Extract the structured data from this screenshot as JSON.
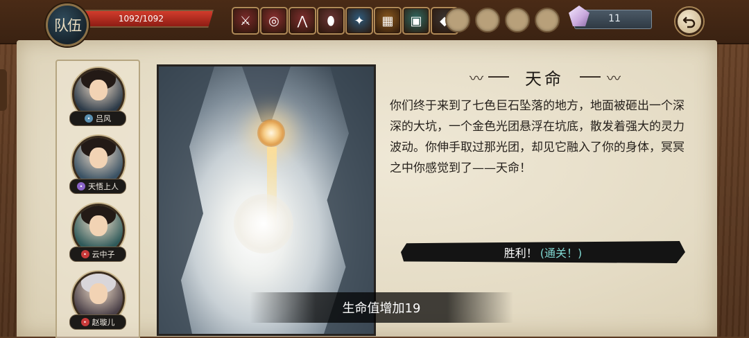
{
  "team": {
    "badge_label": "队伍",
    "hp_text": "1092/1092",
    "hp_fraction": 1.0
  },
  "inventory": {
    "items": [
      {
        "name": "sword-rack-icon",
        "bg": "#7a2a2a",
        "glyph": "⚔"
      },
      {
        "name": "spiral-scroll-icon",
        "bg": "#8a3030",
        "glyph": "◎"
      },
      {
        "name": "claw-icon",
        "bg": "#7d2e2e",
        "glyph": "⋀"
      },
      {
        "name": "rainbow-egg-icon",
        "bg": "#6a3636",
        "glyph": "⬮"
      },
      {
        "name": "crystal-shard-icon",
        "bg": "#2f5a7a",
        "glyph": "✦"
      },
      {
        "name": "puzzle-box-icon",
        "bg": "#8a5a20",
        "glyph": "▦"
      },
      {
        "name": "jade-chest-icon",
        "bg": "#2f6a62",
        "glyph": "▣"
      },
      {
        "name": "dark-stone-icon",
        "bg": "#3a3432",
        "glyph": "◆"
      }
    ],
    "empty_slots": 4
  },
  "currency": {
    "icon": "crystal-gem-icon",
    "count": "11"
  },
  "back_button": {
    "icon": "return-arrow-icon"
  },
  "party": [
    {
      "name": "吕风",
      "role_icon": "water-element-icon",
      "role_color": "#5a8fb0"
    },
    {
      "name": "天悟上人",
      "role_icon": "spiral-element-icon",
      "role_color": "#8a64c8"
    },
    {
      "name": "云中子",
      "role_icon": "fire-element-icon",
      "role_color": "#c83a3a"
    },
    {
      "name": "赵璇儿",
      "role_icon": "fire-element-icon",
      "role_color": "#c83a3a"
    }
  ],
  "event": {
    "title": "天命",
    "story": "你们终于来到了七色巨石坠落的地方，地面被砸出一个深深的大坑，一个金色光团悬浮在坑底，散发着强大的灵力波动。你伸手取过那光团，却见它融入了你的身体，冥冥之中你感觉到了——天命！",
    "result_main": "胜利！",
    "result_sub": "(通关！)"
  },
  "toast": {
    "text": "生命值增加19"
  }
}
